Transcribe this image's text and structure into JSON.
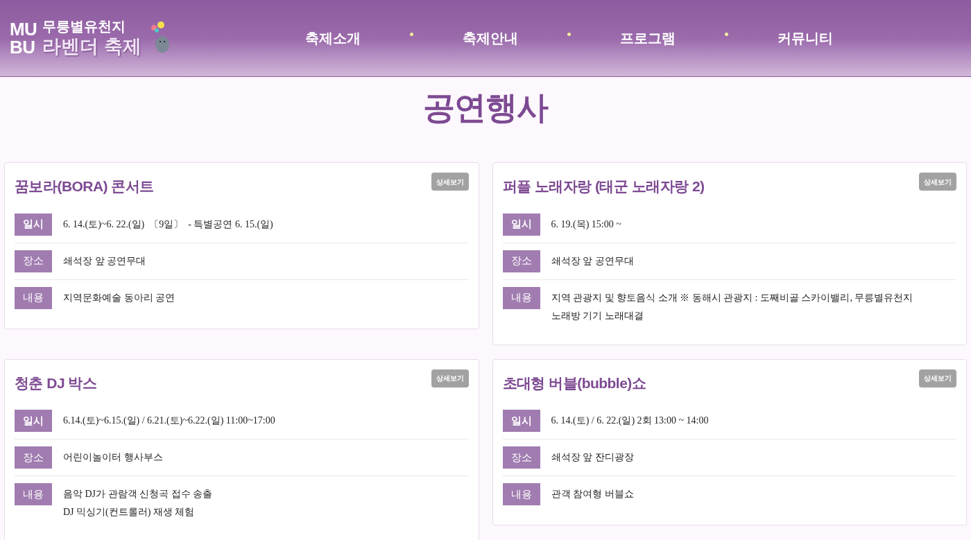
{
  "header": {
    "logo": {
      "mark_top": "MU",
      "mark_bottom": "BU",
      "line1": "무릉별유천지",
      "line2": "라벤더 축제"
    },
    "nav": [
      {
        "label": "축제소개"
      },
      {
        "label": "축제안내"
      },
      {
        "label": "프로그램"
      },
      {
        "label": "커뮤니티"
      }
    ]
  },
  "page_title": "공연행사",
  "events": [
    {
      "title": "꿈보라(BORA) 콘서트",
      "button": "상세보기",
      "rows": [
        {
          "label": "일시",
          "lines": [
            "6. 14.(토)~6. 22.(일)  〔9일〕  - 특별공연 6. 15.(일)"
          ]
        },
        {
          "label": "장소",
          "lines": [
            "쇄석장 앞 공연무대"
          ]
        },
        {
          "label": "내용",
          "lines": [
            "지역문화예술 동아리 공연"
          ]
        }
      ]
    },
    {
      "title": "퍼플 노래자랑 (태군 노래자랑 2)",
      "button": "상세보기",
      "rows": [
        {
          "label": "일시",
          "lines": [
            "6. 19.(목) 15:00 ~"
          ]
        },
        {
          "label": "장소",
          "lines": [
            "쇄석장 앞 공연무대"
          ]
        },
        {
          "label": "내용",
          "lines": [
            "지역 관광지 및 향토음식 소개 ※ 동해시 관광지 : 도째비골 스카이밸리, 무릉별유천지",
            "노래방 기기 노래대결"
          ]
        }
      ]
    },
    {
      "title": "청춘 DJ 박스",
      "button": "상세보기",
      "rows": [
        {
          "label": "일시",
          "lines": [
            "6.14.(토)~6.15.(일) / 6.21.(토)~6.22.(일) 11:00~17:00"
          ]
        },
        {
          "label": "장소",
          "lines": [
            "어린이놀이터 행사부스"
          ]
        },
        {
          "label": "내용",
          "lines": [
            "음악 DJ가 관람객 신청곡 접수 송출",
            "DJ 믹싱기(컨트롤러) 재생 체험"
          ]
        }
      ]
    },
    {
      "title": "초대형 버블(bubble)쇼",
      "button": "상세보기",
      "rows": [
        {
          "label": "일시",
          "lines": [
            "6. 14.(토) / 6. 22.(일) 2회 13:00 ~ 14:00"
          ]
        },
        {
          "label": "장소",
          "lines": [
            "쇄석장 앞 잔디광장"
          ]
        },
        {
          "label": "내용",
          "lines": [
            "관객 참여형 버블쇼"
          ]
        }
      ]
    }
  ]
}
